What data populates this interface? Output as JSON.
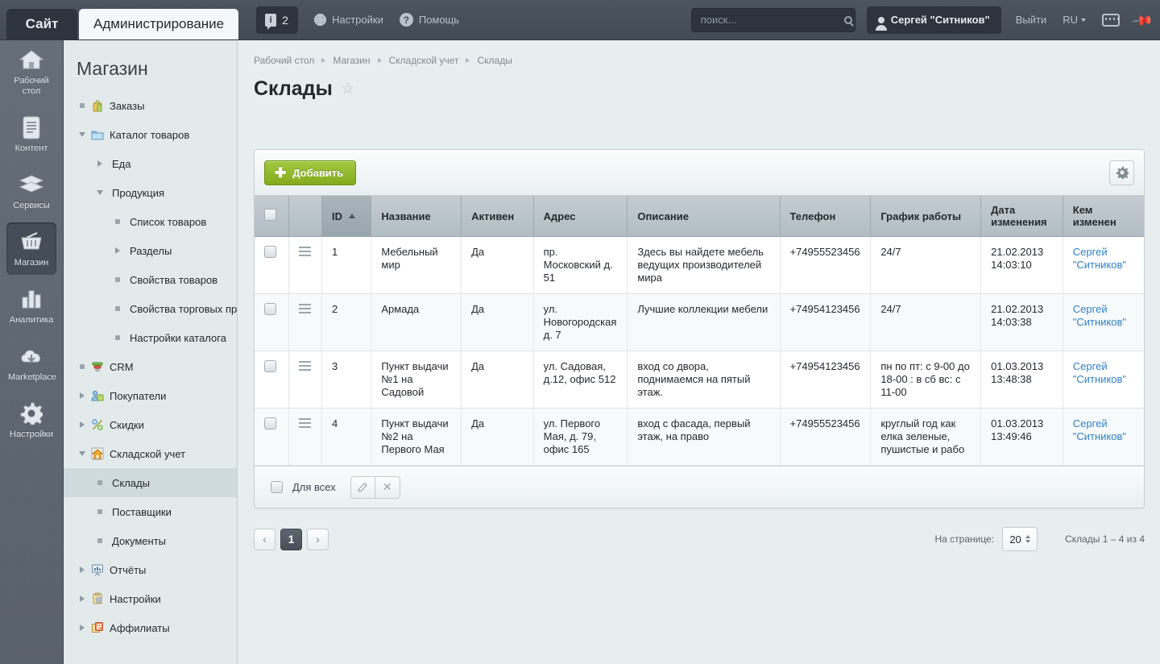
{
  "topbar": {
    "tab_site": "Сайт",
    "tab_admin": "Администрирование",
    "notifications_count": "2",
    "settings_label": "Настройки",
    "help_label": "Помощь",
    "search_placeholder": "поиск...",
    "user_name": "Сергей \"Ситников\"",
    "logout_label": "Выйти",
    "lang_label": "RU"
  },
  "iconbar": {
    "items": [
      {
        "label": "Рабочий стол",
        "icon": "home-icon",
        "active": false
      },
      {
        "label": "Контент",
        "icon": "document-icon",
        "active": false
      },
      {
        "label": "Сервисы",
        "icon": "layers-icon",
        "active": false
      },
      {
        "label": "Магазин",
        "icon": "basket-icon",
        "active": true
      },
      {
        "label": "Аналитика",
        "icon": "bar-chart-icon",
        "active": false
      },
      {
        "label": "Marketplace",
        "icon": "cloud-download-icon",
        "active": false
      },
      {
        "label": "Настройки",
        "icon": "gear-icon",
        "active": false
      }
    ]
  },
  "menu": {
    "title": "Магазин",
    "items": [
      {
        "label": "Заказы",
        "indent": 0,
        "marker": "dot",
        "icon": "orders-icon",
        "selected": false
      },
      {
        "label": "Каталог товаров",
        "indent": 0,
        "marker": "down",
        "icon": "folder-icon",
        "selected": false
      },
      {
        "label": "Еда",
        "indent": 1,
        "marker": "right",
        "icon": "none",
        "selected": false
      },
      {
        "label": "Продукция",
        "indent": 1,
        "marker": "down",
        "icon": "none",
        "selected": false
      },
      {
        "label": "Список товаров",
        "indent": 2,
        "marker": "dot",
        "icon": "none",
        "selected": false
      },
      {
        "label": "Разделы",
        "indent": 2,
        "marker": "right",
        "icon": "none",
        "selected": false
      },
      {
        "label": "Свойства товаров",
        "indent": 2,
        "marker": "dot",
        "icon": "none",
        "selected": false
      },
      {
        "label": "Свойства торговых пр",
        "indent": 2,
        "marker": "dot",
        "icon": "none",
        "selected": false
      },
      {
        "label": "Настройки каталога",
        "indent": 2,
        "marker": "dot",
        "icon": "none",
        "selected": false
      },
      {
        "label": "CRM",
        "indent": 0,
        "marker": "dot",
        "icon": "crm-icon",
        "selected": false
      },
      {
        "label": "Покупатели",
        "indent": 0,
        "marker": "right",
        "icon": "buyers-icon",
        "selected": false
      },
      {
        "label": "Скидки",
        "indent": 0,
        "marker": "right",
        "icon": "percent-icon",
        "selected": false
      },
      {
        "label": "Складской учет",
        "indent": 0,
        "marker": "down",
        "icon": "warehouse-icon",
        "selected": false
      },
      {
        "label": "Склады",
        "indent": 1,
        "marker": "dot",
        "icon": "none",
        "selected": true
      },
      {
        "label": "Поставщики",
        "indent": 1,
        "marker": "dot",
        "icon": "none",
        "selected": false
      },
      {
        "label": "Документы",
        "indent": 1,
        "marker": "dot",
        "icon": "none",
        "selected": false
      },
      {
        "label": "Отчёты",
        "indent": 0,
        "marker": "right",
        "icon": "reports-icon",
        "selected": false
      },
      {
        "label": "Настройки",
        "indent": 0,
        "marker": "right",
        "icon": "settings-icon",
        "selected": false
      },
      {
        "label": "Аффилиаты",
        "indent": 0,
        "marker": "right",
        "icon": "affiliates-icon",
        "selected": false
      }
    ]
  },
  "breadcrumb": [
    "Рабочий стол",
    "Магазин",
    "Складской учет",
    "Склады"
  ],
  "page": {
    "title": "Склады"
  },
  "toolbar": {
    "add_label": "Добавить"
  },
  "grid": {
    "columns": [
      "",
      "",
      "ID",
      "Название",
      "Активен",
      "Адрес",
      "Описание",
      "Телефон",
      "График работы",
      "Дата изменения",
      "Кем изменен"
    ],
    "sorted_column": "ID",
    "sort_direction": "asc",
    "rows": [
      {
        "id": "1",
        "name": "Мебельный мир",
        "active": "Да",
        "address": "пр. Московский д. 51",
        "description": "Здесь вы найдете мебель ведущих производителей мира",
        "phone": "+74955523456",
        "schedule": "24/7",
        "modified_date": "21.02.2013 14:03:10",
        "modified_by": "Сергей \"Ситников\""
      },
      {
        "id": "2",
        "name": "Армада",
        "active": "Да",
        "address": "ул. Новогородская д. 7",
        "description": "Лучшие коллекции мебели",
        "phone": "+74954123456",
        "schedule": "24/7",
        "modified_date": "21.02.2013 14:03:38",
        "modified_by": "Сергей \"Ситников\""
      },
      {
        "id": "3",
        "name": "Пункт выдачи №1 на Садовой",
        "active": "Да",
        "address": "ул. Садовая, д.12, офис 512",
        "description": "вход со двора, поднимаемся на пятый этаж.",
        "phone": "+74954123456",
        "schedule": "пн по пт: с 9-00 до 18-00 : в сб вс: с 11-00",
        "modified_date": "01.03.2013 13:48:38",
        "modified_by": "Сергей \"Ситников\""
      },
      {
        "id": "4",
        "name": "Пункт выдачи №2 на Первого Мая",
        "active": "Да",
        "address": "ул. Первого Мая, д. 79, офис 165",
        "description": "вход с фасада, первый этаж, на право",
        "phone": "+74955523456",
        "schedule": "круглый год как елка зеленые, пушистые и рабо",
        "modified_date": "01.03.2013 13:49:46",
        "modified_by": "Сергей \"Ситников\""
      }
    ],
    "footer_label": "Для всех"
  },
  "pager": {
    "prev": "‹",
    "current_page": "1",
    "next": "›",
    "perpage_label": "На странице:",
    "perpage_value": "20",
    "total_label": "Склады 1 – 4 из 4"
  }
}
